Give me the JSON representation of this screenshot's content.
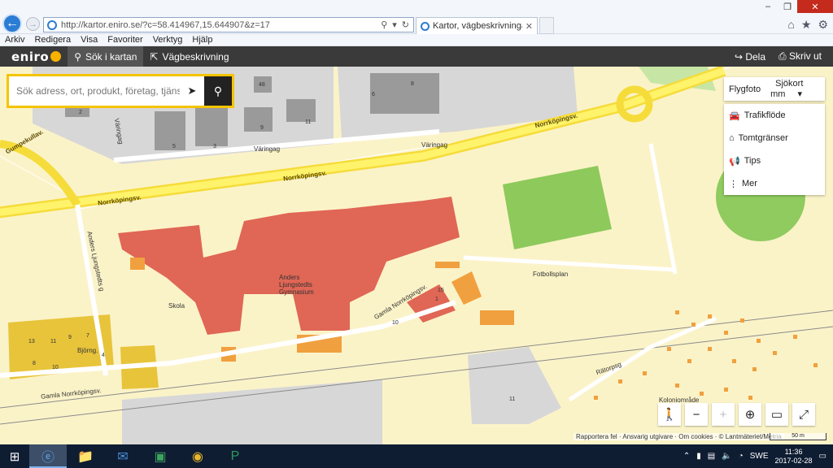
{
  "browser": {
    "url": "http://kartor.eniro.se/?c=58.414967,15.644907&z=17",
    "tab_title": "Kartor, vägbeskrivningar, fl...",
    "menu": [
      "Arkiv",
      "Redigera",
      "Visa",
      "Favoriter",
      "Verktyg",
      "Hjälp"
    ]
  },
  "eniro": {
    "logo": "eniro",
    "search_tab": "Sök i kartan",
    "directions_tab": "Vägbeskrivning",
    "share": "Dela",
    "print": "Skriv ut"
  },
  "search": {
    "placeholder": "Sök adress, ort, produkt, företag, tjänst"
  },
  "layers": {
    "photo": "Flygfoto",
    "nautical": "Sjökort mm"
  },
  "panel": [
    {
      "label": "Trafikflöde",
      "icon": "car-icon"
    },
    {
      "label": "Tomtgränser",
      "icon": "plot-icon"
    },
    {
      "label": "Tips",
      "icon": "megaphone-icon"
    },
    {
      "label": "Mer",
      "icon": "more-icon"
    }
  ],
  "map_labels": {
    "norrkopingsv_1": "Norrköpingsv.",
    "norrkopingsv_2": "Norrköpingsv.",
    "norrkopingsv_3": "Norrköpingsv.",
    "gumpekullav": "Gumpekullav.",
    "varingag_1": "Väringag",
    "varingag_2": "Väringag",
    "varingag_3": "Väringag",
    "anders_ljungstedts": "Anders Ljungstedts g",
    "school_name": "Anders\nLjungstedts\nGymnasium",
    "skola": "Skola",
    "gamla_norrkopingsv_1": "Gamla Norrköpingsv.",
    "gamla_norrkopingsv_2": "Gamla Norrköpingsv.",
    "fotbollsplan": "Fotbollsplan",
    "bjorng": "Björng.",
    "ratorpsg": "Rätorpsg",
    "koloniomrade": "Koloniområde",
    "n48": "48",
    "n2": "2",
    "n4": "4",
    "n5": "5",
    "n3": "3",
    "n9": "9",
    "n11": "11",
    "n6": "6",
    "n13": "13",
    "n11b": "11",
    "n9b": "9",
    "n7": "7",
    "n10": "10",
    "n8": "8",
    "n4b": "4",
    "n15": "15",
    "n1": "1",
    "n10b": "10",
    "n11c": "11"
  },
  "attribution": "Rapportera fel · Ansvarig utgivare · Om cookies · © Lantmäteriet/Metria",
  "scale_label": "50 m",
  "taskbar": {
    "lang": "SWE",
    "time": "11:36",
    "date": "2017-02-28"
  }
}
